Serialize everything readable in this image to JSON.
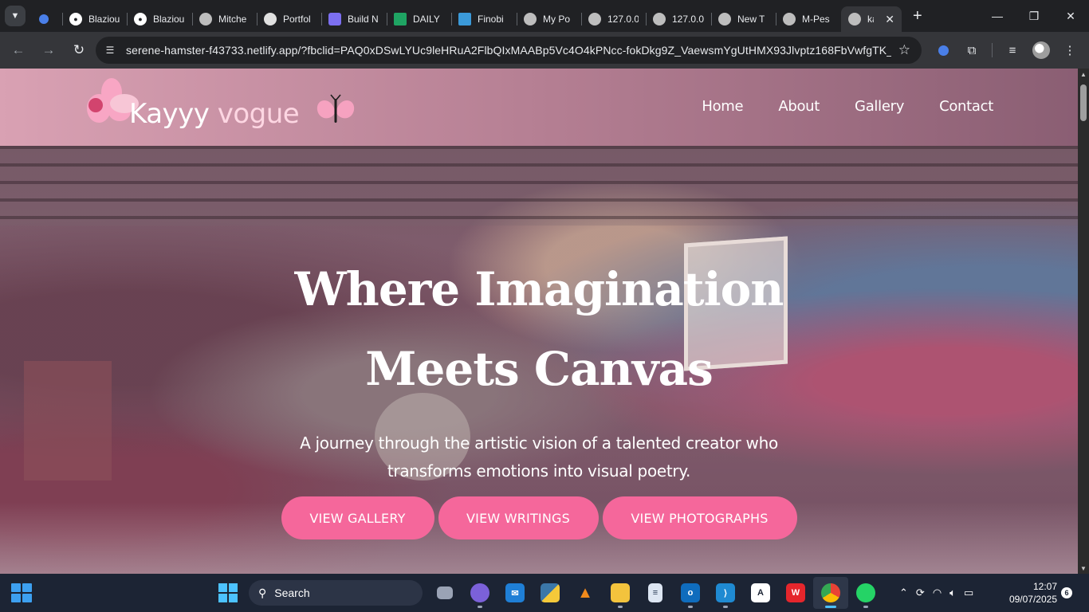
{
  "browser": {
    "tabs": [
      {
        "title": "",
        "color": "#4a7fe8"
      },
      {
        "title": "Blaziou",
        "color": "#ffffff"
      },
      {
        "title": "Blaziou",
        "color": "#ffffff"
      },
      {
        "title": "Mitche",
        "color": "#bdbdbd"
      },
      {
        "title": "Portfol",
        "color": "#e0e0e0"
      },
      {
        "title": "Build N",
        "color": "#7c6ff0"
      },
      {
        "title": "DAILY",
        "color": "#1fa463"
      },
      {
        "title": "Finobi",
        "color": "#3b9ad9"
      },
      {
        "title": "My Po",
        "color": "#bdbdbd"
      },
      {
        "title": "127.0.0",
        "color": "#bdbdbd"
      },
      {
        "title": "127.0.0",
        "color": "#bdbdbd"
      },
      {
        "title": "New T",
        "color": "#bdbdbd"
      },
      {
        "title": "M-Pes",
        "color": "#bdbdbd"
      },
      {
        "title": "ka",
        "color": "#bdbdbd"
      }
    ],
    "url": "serene-hamster-f43733.netlify.app/?fbclid=PAQ0xDSwLYUc9leHRuA2FlbQIxMAABp5Vc4O4kPNcc-fokDkg9Z_VaewsmYgUtHMX93Jlvptz168FbVwfgTK_m-..."
  },
  "site": {
    "logo": {
      "part1": "Kayyy",
      "part2": "vogue"
    },
    "nav": [
      "Home",
      "About",
      "Gallery",
      "Contact"
    ],
    "hero": {
      "title": "Where Imagination Meets Canvas",
      "subtitle": "A journey through the artistic vision of a talented creator who transforms emotions into visual poetry.",
      "buttons": [
        "VIEW GALLERY",
        "VIEW WRITINGS",
        "VIEW PHOTOGRAPHS"
      ]
    },
    "colors": {
      "accent": "#f5679b",
      "header_start": "#d9a1b3",
      "header_end": "#8a5e73"
    }
  },
  "taskbar": {
    "search_label": "Search",
    "time": "12:07",
    "date": "09/07/2025",
    "notifications": "6",
    "apps": [
      "task-view-icon",
      "meet-icon",
      "mail-icon",
      "python-icon",
      "vlc-icon",
      "file-explorer-icon",
      "notepad-icon",
      "outlook-icon",
      "vscode-icon",
      "tasks-icon",
      "wps-office-icon",
      "chrome-icon",
      "whatsapp-icon"
    ]
  }
}
